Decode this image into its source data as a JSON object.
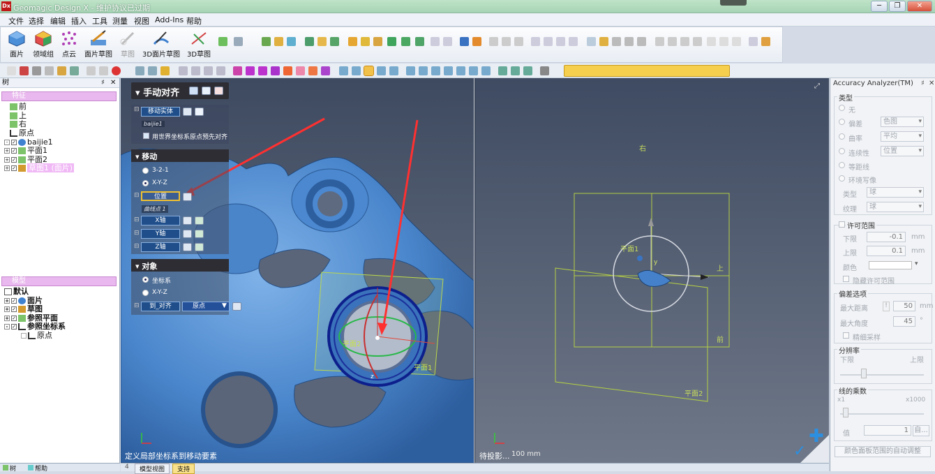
{
  "window": {
    "logo": "Dx",
    "title": "Geomagic Design X - 维护协议已过期",
    "min": "─",
    "restore": "❐",
    "close": "✕"
  },
  "menu": [
    "文件",
    "选择",
    "编辑",
    "插入",
    "工具",
    "测量",
    "视图",
    "Add-Ins",
    "帮助"
  ],
  "ribbon": [
    {
      "label": "面片"
    },
    {
      "label": "领域组"
    },
    {
      "label": "点云"
    },
    {
      "label": "面片草图"
    },
    {
      "label": "草图"
    },
    {
      "label": "3D面片草图"
    },
    {
      "label": "3D草图"
    }
  ],
  "left_panel": {
    "header": "树",
    "pin": "♯",
    "close": "✕",
    "features_title": "特征",
    "features": [
      "前",
      "上",
      "右",
      "原点",
      "baijie1",
      "平面1",
      "平面2",
      "草图1 (面片)"
    ],
    "model_title": "模型",
    "model": [
      "默认",
      "面片",
      "草图",
      "参照平面",
      "参照坐标系",
      "原点"
    ],
    "tabs": [
      "树",
      "帮助"
    ]
  },
  "manual_align": {
    "title": "手动对齐",
    "move_entity_label": "移动实体",
    "move_entity_value": "baijie1",
    "world_origin_check": "用世界坐标系原点预先对齐",
    "move_title": "移动",
    "opt_321": "3-2-1",
    "opt_xyz": "X-Y-Z",
    "position_label": "位置",
    "position_value": "曲线点 1",
    "x_axis": "X轴",
    "y_axis": "Y轴",
    "z_axis": "Z轴",
    "target_title": "对象",
    "opt_coord": "坐标系",
    "opt_xyz2": "X-Y-Z",
    "to_align_label": "到_对齐",
    "to_align_value": "原点"
  },
  "viewport": {
    "left_status": "定义局部坐标系到移动要素",
    "right_status": "待投影...",
    "scale": "100 mm",
    "plane_label_1": "平面1",
    "plane_label_2": "平面2",
    "plane_label_3": "平面1",
    "label_right": "右",
    "label_up": "上",
    "label_front": "前",
    "label_plane2": "平面2",
    "axis_y": "y",
    "axis_z": "z",
    "axis_x": "x",
    "mesh_color": "#3f7fc6",
    "tabs": [
      "模型视图",
      "支持"
    ]
  },
  "accuracy": {
    "title": "Accuracy Analyzer(TM)",
    "type_group": "类型",
    "opt_none": "无",
    "opt_deviation": "偏差",
    "opt_curvature": "曲率",
    "opt_continuity": "连续性",
    "opt_isoline": "等距线",
    "opt_env": "环境写像",
    "combo_deviation": "色图",
    "combo_curvature": "平均",
    "combo_continuity": "位置",
    "label_type": "类型",
    "combo_type": "球",
    "label_texture": "纹理",
    "combo_texture": "球",
    "tolerance_group": "许可范围",
    "lower": "下限",
    "lower_value": "-0.1",
    "upper": "上限",
    "upper_value": "0.1",
    "unit": "mm",
    "color": "颜色",
    "hide_tolerance": "隐藏许可范围",
    "deviation_options": "偏差选项",
    "max_distance": "最大距离",
    "max_distance_value": "50",
    "max_angle": "最大角度",
    "max_angle_value": "45",
    "deg": "°",
    "fine_sampling": "精细采样",
    "resolution": "分辨率",
    "res_lower": "下限",
    "res_upper": "上限",
    "line_multiplier": "线的乘数",
    "x1": "x1",
    "x1000": "x1000",
    "value_label": "值",
    "value": "1",
    "auto": "自...",
    "auto_adjust": "颜色面板范围的自动调整"
  }
}
